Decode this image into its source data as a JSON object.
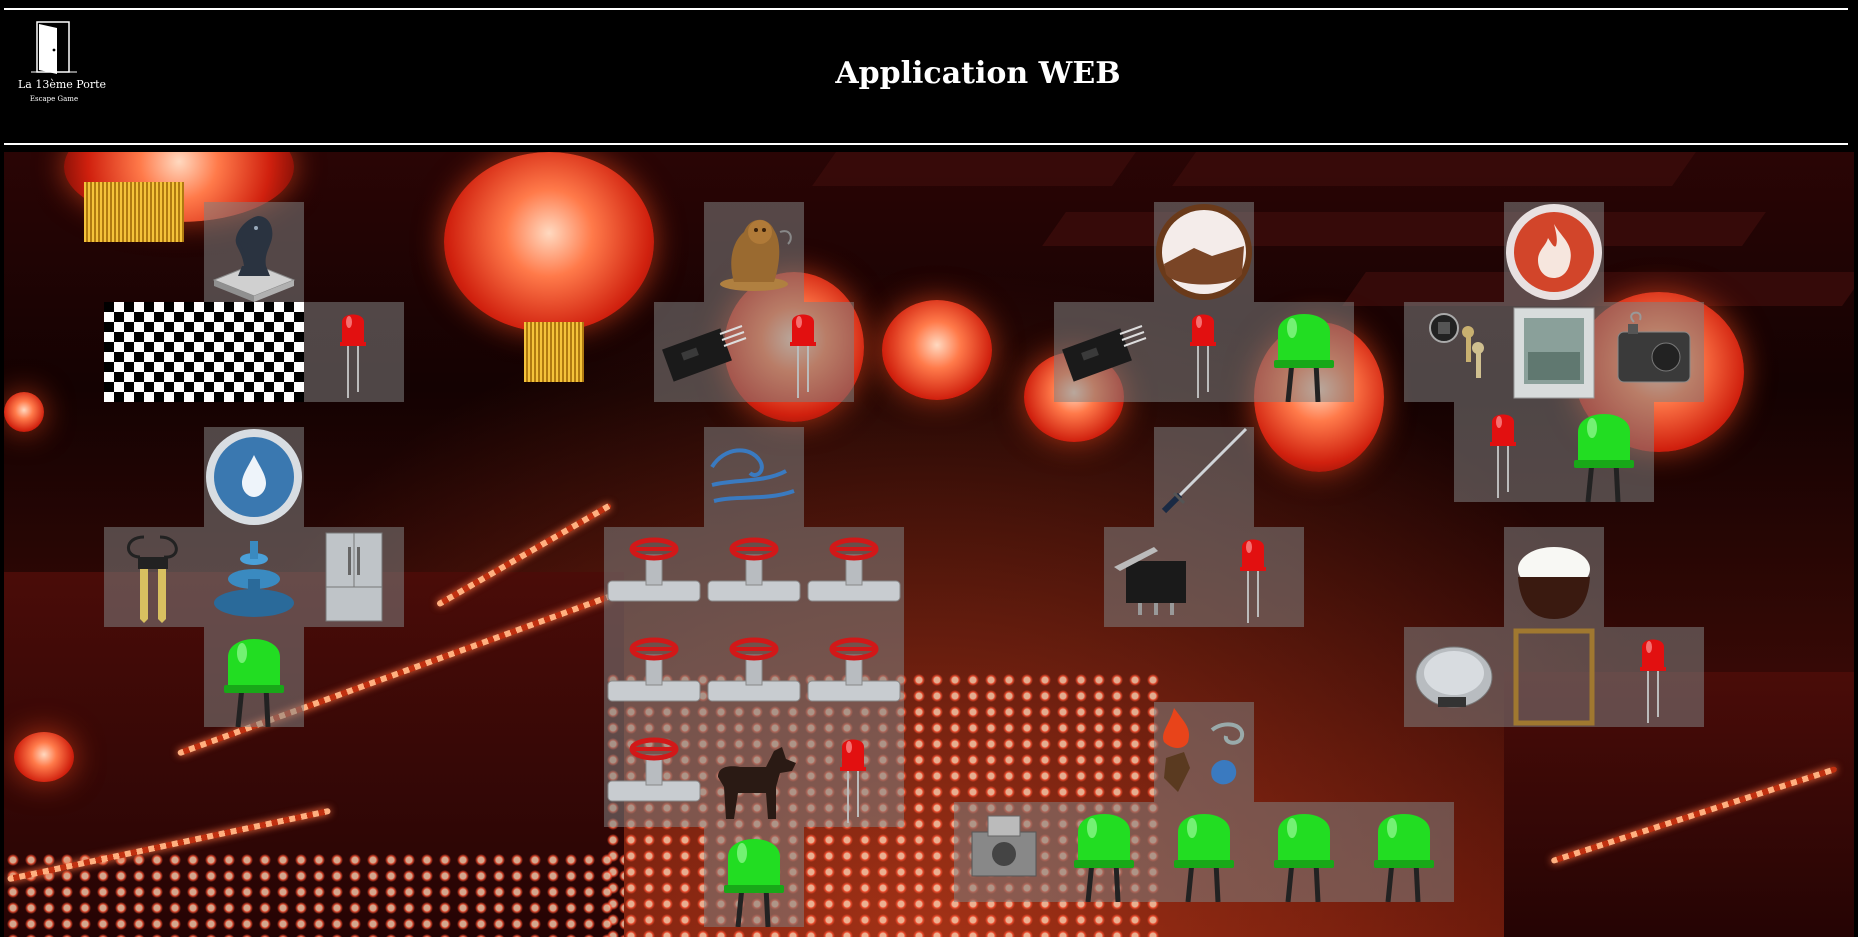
{
  "header": {
    "title": "Application WEB",
    "logo": {
      "brand": "La 13ème Porte",
      "tagline": "Escape Game"
    }
  },
  "colors": {
    "tile": "#808080",
    "led_red": "#e21010",
    "led_green": "#22dd22",
    "header_bg": "#000000",
    "header_text": "#ffffff"
  },
  "groups": [
    {
      "name": "chess",
      "items": [
        "chess-knight-icon",
        "checkerboard-icon",
        "red-led-icon"
      ]
    },
    {
      "name": "lion",
      "items": [
        "lion-statue-icon",
        "sensor-module-icon",
        "red-led-icon"
      ]
    },
    {
      "name": "sand",
      "items": [
        "sand-badge-icon",
        "sensor-module-icon",
        "red-led-icon",
        "green-led-icon"
      ]
    },
    {
      "name": "fire",
      "items": [
        "fire-badge-icon",
        "key-switch-icon",
        "panel-icon",
        "smoke-machine-icon",
        "red-led-icon",
        "green-led-icon"
      ]
    },
    {
      "name": "water",
      "items": [
        "water-drop-badge-icon",
        "moisture-sensor-icon",
        "fountain-icon",
        "fridge-icon",
        "green-led-icon"
      ]
    },
    {
      "name": "wind",
      "items": [
        "wind-badge-icon",
        "valve-icon",
        "dog-icon",
        "red-led-icon",
        "green-led-icon"
      ]
    },
    {
      "name": "sword",
      "items": [
        "katana-icon",
        "limit-switch-icon",
        "red-led-icon"
      ]
    },
    {
      "name": "rice",
      "items": [
        "rice-bowl-icon",
        "kitchen-scale-icon",
        "frame-icon",
        "red-led-icon"
      ]
    },
    {
      "name": "elements",
      "items": [
        "elements-icon",
        "push-button-icon",
        "green-led-icon"
      ]
    }
  ]
}
